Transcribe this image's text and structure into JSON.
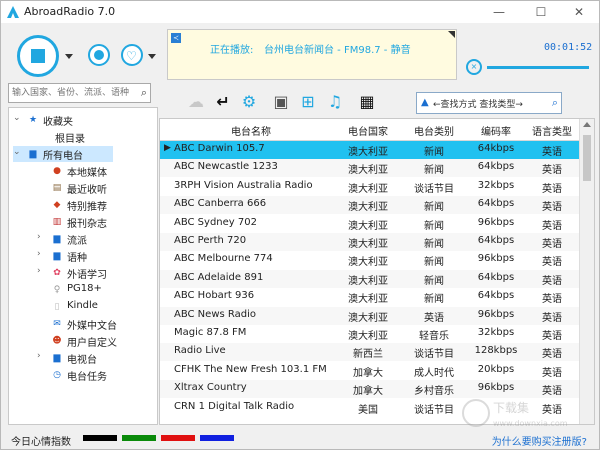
{
  "app": {
    "title": "AbroadRadio 7.0"
  },
  "window_controls": {
    "minimize": "—",
    "maximize": "☐",
    "close": "✕"
  },
  "now_playing": {
    "label": "正在播放:",
    "text": "台州电台新闻台 - FM98.7 - 静音"
  },
  "timer": "00:01:52",
  "search": {
    "placeholder": "输入国家、省份、流派、语种"
  },
  "search_mode": {
    "text": "←查找方式  查找类型→"
  },
  "tree": {
    "favorites": "收藏夹",
    "root_dir": "根目录",
    "all_stations": "所有电台",
    "children": [
      "本地媒体",
      "最近收听",
      "特别推荐",
      "报刊杂志",
      "流派",
      "语种",
      "外语学习",
      "PG18+",
      "Kindle",
      "外媒中文台",
      "用户自定义",
      "电视台",
      "电台任务"
    ]
  },
  "table": {
    "headers": [
      "电台名称",
      "电台国家",
      "电台类别",
      "编码率",
      "语言类型"
    ],
    "rows": [
      [
        "ABC Darwin 105.7",
        "澳大利亚",
        "新闻",
        "64kbps",
        "英语"
      ],
      [
        "ABC Newcastle 1233",
        "澳大利亚",
        "新闻",
        "64kbps",
        "英语"
      ],
      [
        "3RPH Vision Australia Radio",
        "澳大利亚",
        "谈话节目",
        "32kbps",
        "英语"
      ],
      [
        "ABC Canberra 666",
        "澳大利亚",
        "新闻",
        "64kbps",
        "英语"
      ],
      [
        "ABC Sydney 702",
        "澳大利亚",
        "新闻",
        "96kbps",
        "英语"
      ],
      [
        "ABC Perth 720",
        "澳大利亚",
        "新闻",
        "64kbps",
        "英语"
      ],
      [
        "ABC Melbourne 774",
        "澳大利亚",
        "新闻",
        "96kbps",
        "英语"
      ],
      [
        "ABC Adelaide 891",
        "澳大利亚",
        "新闻",
        "64kbps",
        "英语"
      ],
      [
        "ABC Hobart 936",
        "澳大利亚",
        "新闻",
        "64kbps",
        "英语"
      ],
      [
        "ABC News Radio",
        "澳大利亚",
        "英语",
        "96kbps",
        "英语"
      ],
      [
        "Magic 87.8 FM",
        "澳大利亚",
        "轻音乐",
        "32kbps",
        "英语"
      ],
      [
        "Radio Live",
        "新西兰",
        "谈话节目",
        "128kbps",
        "英语"
      ],
      [
        "CFHK The New Fresh 103.1 FM",
        "加拿大",
        "成人时代",
        "20kbps",
        "英语"
      ],
      [
        "Xltrax Country",
        "加拿大",
        "乡村音乐",
        "96kbps",
        "英语"
      ],
      [
        "CRN 1 Digital Talk Radio",
        "美国",
        "谈话节目",
        "",
        "英语"
      ]
    ]
  },
  "status": {
    "mood_label": "今日心情指数",
    "why_register": "为什么要购买注册版?"
  },
  "mood_colors": [
    "#000000",
    "#0a8a0a",
    "#e01010",
    "#1020e0"
  ],
  "accent_color": "#21a7e0",
  "selected_row_color": "#21c1f0",
  "watermark": "下载集  www.downxia.com"
}
